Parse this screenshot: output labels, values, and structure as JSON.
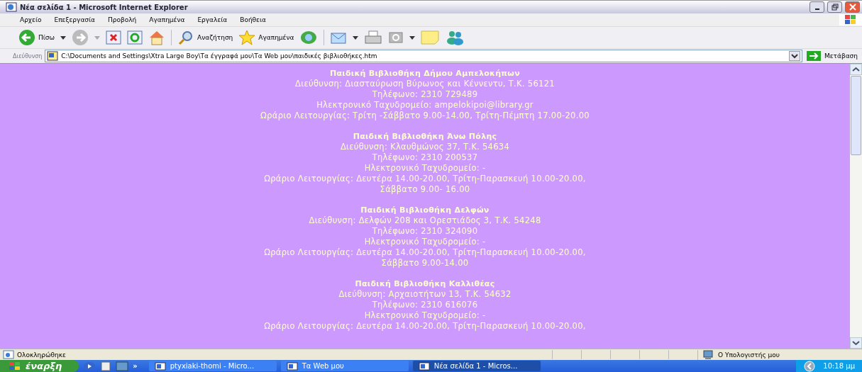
{
  "window": {
    "title": "Νέα σελίδα 1 - Microsoft Internet Explorer"
  },
  "menu": [
    "Αρχείο",
    "Επεξεργασία",
    "Προβολή",
    "Αγαπημένα",
    "Εργαλεία",
    "Βοήθεια"
  ],
  "toolbar": {
    "back": "Πίσω",
    "search": "Αναζήτηση",
    "favorites": "Αγαπημένα"
  },
  "address": {
    "label": "Διεύθυνση",
    "value": "C:\\Documents and Settings\\Xtra Large Boy\\Τα έγγραφά μου\\Τα Web μου\\παιδικές βιβλιοθήκες.htm",
    "go": "Μετάβαση"
  },
  "libraries": [
    {
      "title": "Παιδική Βιβλιοθήκη Δήμου Αμπελοκήπων",
      "lines": [
        "Διεύθυνση: Διασταύρωση Βύρωνος και Κέννεντυ, Τ.Κ. 56121",
        "Τηλέφωνο: 2310 729489",
        "Ηλεκτρονικό Ταχυδρομείο: ampelokipoi@library.gr",
        "Ωράριο Λειτουργίας: Τρίτη -Σάββατο 9.00-14.00, Τρίτη-Πέμπτη 17.00-20.00"
      ]
    },
    {
      "title": "Παιδική Βιβλιοθήκη Άνω Πόλης",
      "lines": [
        "Διεύθυνση: Κλαυθμώνος 37, Τ.Κ. 54634",
        "Τηλέφωνο: 2310 200537",
        "Ηλεκτρονικό Ταχυδρομείο: -",
        "Ωράριο Λειτουργίας: Δευτέρα 14.00-20.00, Τρίτη-Παρασκευή 10.00-20.00,",
        "Σάββατο 9.00- 16.00"
      ]
    },
    {
      "title": "Παιδική Βιβλιοθήκη Δελφών",
      "lines": [
        "Διεύθυνση: Δελφών 208 και Ορεστιάδος 3, Τ.Κ. 54248",
        "Τηλέφωνο: 2310 324090",
        "Ηλεκτρονικό Ταχυδρομείο: -",
        "Ωράριο Λειτουργίας: Δευτέρα 14.00-20.00, Τρίτη-Παρασκευή 10.00-20.00,",
        "Σάββατο 9.00-14.00"
      ]
    },
    {
      "title": "Παιδική Βιβλιοθήκη Καλλιθέας",
      "lines": [
        "Διεύθυνση: Αρχαιοτήτων 13, Τ.Κ. 54632",
        "Τηλέφωνο: 2310 616076",
        "Ηλεκτρονικό Ταχυδρομείο: -",
        "Ωράριο Λειτουργίας: Δευτέρα 14.00-20.00, Τρίτη-Παρασκευή 10.00-20.00,"
      ]
    }
  ],
  "status_bar": {
    "status": "Ολοκληρώθηκε",
    "zone": "Ο Υπολογιστής μου"
  },
  "taskbar": {
    "start": "έναρξη",
    "more": "»",
    "tasks": [
      {
        "label": "ptyxiaki-thomi - Micro...",
        "selected": false
      },
      {
        "label": "Τα Web μου",
        "selected": false
      },
      {
        "label": "Νέα σελίδα 1 - Micros...",
        "selected": true
      }
    ],
    "clock": "10:18 μμ"
  }
}
